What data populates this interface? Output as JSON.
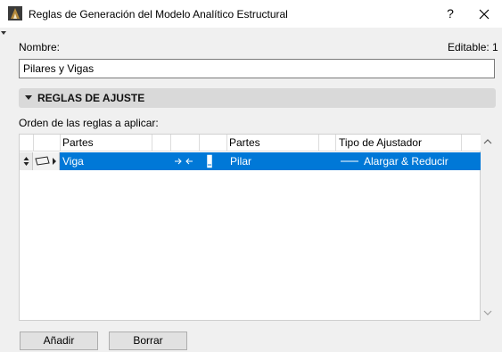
{
  "window": {
    "title": "Reglas de Generación del Modelo Analítico Estructural",
    "help_label": "?",
    "close_icon": "close-icon",
    "app_icon": "archicad-icon"
  },
  "form": {
    "name_label": "Nombre:",
    "editable_label": "Editable: 1",
    "name_value": "Pilares y Vigas"
  },
  "section": {
    "label": "REGLAS DE AJUSTE",
    "expanded": true
  },
  "rules": {
    "order_label": "Orden de las reglas a aplicar:",
    "columns": [
      "Partes",
      "Partes",
      "Tipo de Ajustador"
    ],
    "rows": [
      {
        "part_a": "Viga",
        "connection_icon": "arrows-toward-icon",
        "part_b_icon": "column-icon",
        "part_b": "Pilar",
        "adjuster": "Alargar & Reducir",
        "selected": true
      }
    ]
  },
  "buttons": {
    "add": "Añadir",
    "delete": "Borrar"
  },
  "colors": {
    "selection": "#0078d7",
    "section_bar": "#d9d9d9",
    "background": "#f0f0f0"
  }
}
